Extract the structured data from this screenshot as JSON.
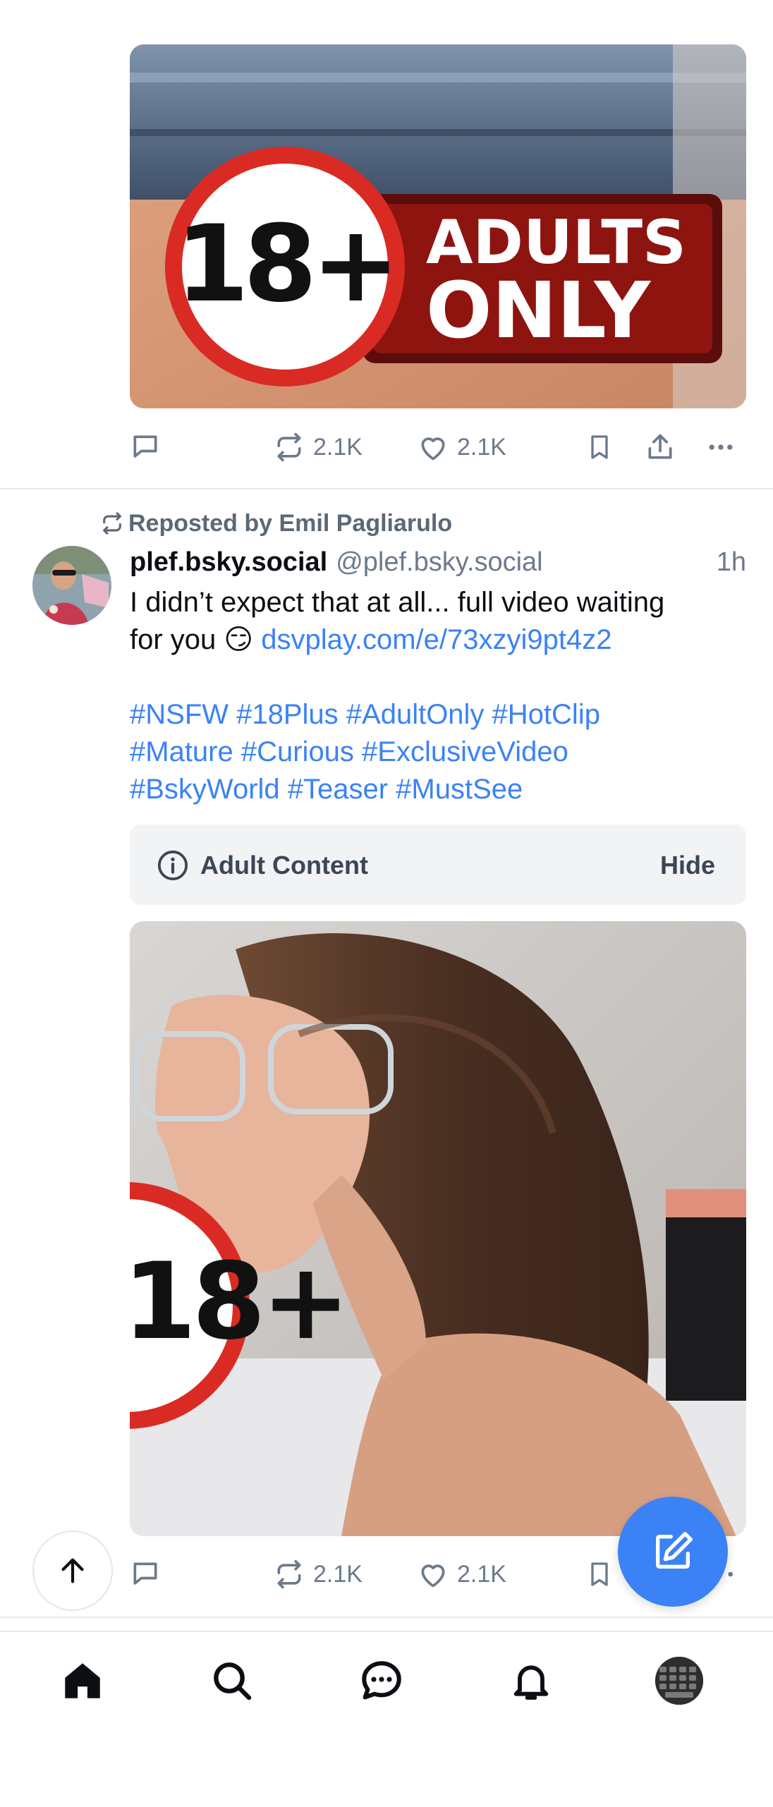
{
  "post1": {
    "badge": {
      "number": "18+",
      "line1": "ADULTS",
      "line2": "ONLY"
    },
    "actions": {
      "repost_count": "2.1K",
      "like_count": "2.1K"
    }
  },
  "post2": {
    "repost_banner": "Reposted by Emil Pagliarulo",
    "display_name": "plef.bsky.social",
    "handle": "@plef.bsky.social",
    "time": "1h",
    "text_line1": "I didn’t expect that at all... full video waiting",
    "text_line2_prefix": "for you 😏 ",
    "link": "dsvplay.com/e/73xzyi9pt4z2",
    "hashtags_line1": "#NSFW #18Plus #AdultOnly #HotClip",
    "hashtags_line2": "#Mature #Curious #ExclusiveVideo",
    "hashtags_line3": "#BskyWorld #Teaser #MustSee",
    "content_warning": {
      "label": "Adult Content",
      "action": "Hide"
    },
    "badge": {
      "number": "18+"
    },
    "actions": {
      "repost_count": "2.1K",
      "like_count": "2.1K"
    }
  },
  "colors": {
    "accent": "#3b82f6",
    "muted": "#6b7a8c",
    "badge_red": "#d92b24"
  },
  "nav": {
    "items": [
      "home-icon",
      "search-icon",
      "chat-icon",
      "bell-icon",
      "avatar"
    ]
  }
}
